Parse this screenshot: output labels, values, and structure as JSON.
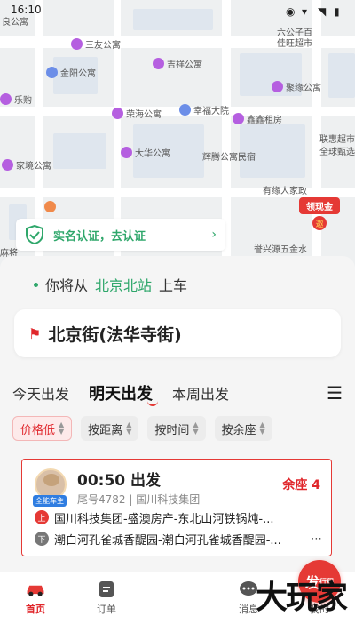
{
  "status": {
    "time": "16:10"
  },
  "map": {
    "pois": [
      "良公寓",
      "三友公寓",
      "六公子百",
      "佳旺超市",
      "金阳公寓",
      "吉祥公寓",
      "聚缘公寓",
      "乐购",
      "荣海公寓",
      "幸福大院",
      "鑫鑫租房",
      "联惠超市",
      "全球甄选",
      "大华公寓",
      "辉腾公寓民宿",
      "家境公寓",
      "有缘人家政",
      "誉兴源五金水",
      "麻将"
    ],
    "verify_label": "实名认证，去认证",
    "cash_label": "领现金",
    "cash_coin": "邀"
  },
  "panel": {
    "from_prefix": "你将从",
    "from_station": "北京北站",
    "from_suffix": "上车",
    "destination": "北京街(法华寺街)",
    "tabs": [
      "今天出发",
      "明天出发",
      "本周出发"
    ],
    "filters": [
      "价格低",
      "按距离",
      "按时间",
      "按余座"
    ]
  },
  "trip": {
    "owner_badge": "全能车主",
    "depart": "00:50 出发",
    "sub": "尾号4782 | 国川科技集团",
    "seats": "余座 4",
    "board_tag": "上",
    "board": "国川科技集团-盛澳房产-东北山河铁锅炖-...",
    "alight_tag": "下",
    "alight": "潮白河孔雀城香醍园-潮白河孔雀城香醍园-...",
    "more": "⋯"
  },
  "nav": {
    "home": "首页",
    "orders": "订单",
    "post": "发",
    "post_small": "行程",
    "messages": "消息",
    "mine": "我的",
    "watermark": "大玩家"
  },
  "colors": {
    "accent": "#e53935",
    "green": "#2fa76b"
  }
}
